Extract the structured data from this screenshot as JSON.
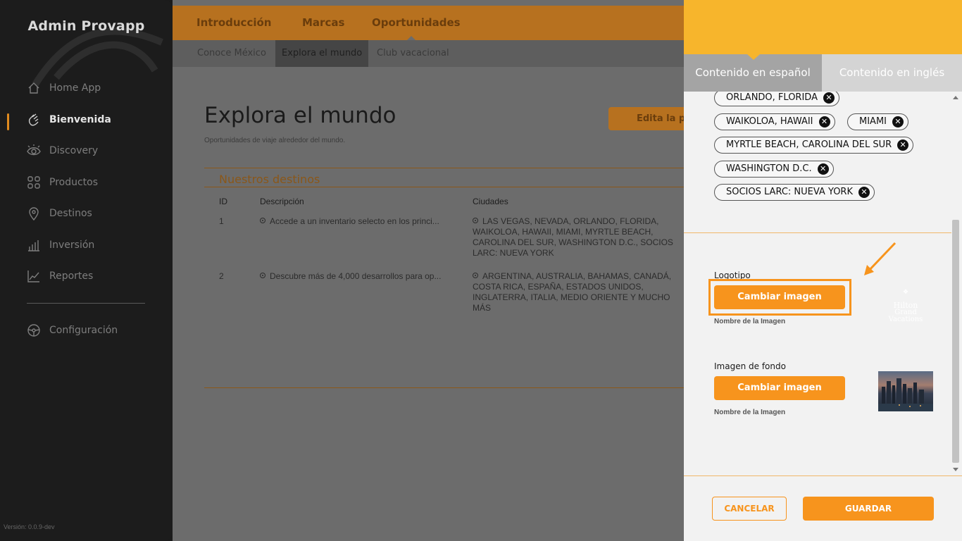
{
  "sidebar": {
    "brand": "Admin Provapp",
    "items": [
      {
        "label": "Home App",
        "icon": "home-icon"
      },
      {
        "label": "Bienvenida",
        "icon": "wave-hand-icon",
        "active": true
      },
      {
        "label": "Discovery",
        "icon": "eye-icon"
      },
      {
        "label": "Productos",
        "icon": "grid-icon"
      },
      {
        "label": "Destinos",
        "icon": "location-pin-icon"
      },
      {
        "label": "Inversión",
        "icon": "bar-chart-icon"
      },
      {
        "label": "Reportes",
        "icon": "line-chart-icon"
      }
    ],
    "settings": {
      "label": "Configuración",
      "icon": "steering-wheel-icon"
    },
    "version": "Versión: 0.0.9-dev"
  },
  "topnav": {
    "tabs": [
      "Introducción",
      "Marcas",
      "Oportunidades"
    ],
    "subtabs": [
      "Conoce México",
      "Explora el mundo",
      "Club vacacional"
    ]
  },
  "main": {
    "title": "Explora el mundo",
    "subtitle": "Oportunidades de viaje alrededor del mundo.",
    "edit_button": "Edita la po",
    "section_title": "Nuestros destinos",
    "table": {
      "headers": [
        "ID",
        "Descripción",
        "Ciudades"
      ],
      "rows": [
        {
          "id": "1",
          "description": "Accede a un inventario selecto en los princi...",
          "cities": "LAS VEGAS, NEVADA, ORLANDO, FLORIDA, WAIKOLOA, HAWAII, MIAMI, MYRTLE BEACH, CAROLINA DEL SUR, WASHINGTON D.C., SOCIOS LARC: NUEVA YORK"
        },
        {
          "id": "2",
          "description": "Descubre más de 4,000 desarrollos para op...",
          "cities": "ARGENTINA, AUSTRALIA, BAHAMAS, CANADÁ, COSTA RICA, ESPAÑA, ESTADOS UNIDOS, INGLATERRA, ITALIA, MEDIO ORIENTE Y MUCHO MÁS"
        }
      ]
    }
  },
  "panel": {
    "tabs": [
      "Contenido en español",
      "Contenido en inglés"
    ],
    "chips": [
      "ORLANDO, FLORIDA",
      "WAIKOLOA, HAWAII",
      "MIAMI",
      "MYRTLE BEACH, CAROLINA DEL SUR",
      "WASHINGTON D.C.",
      "SOCIOS LARC: NUEVA YORK"
    ],
    "logo": {
      "label": "Logotipo",
      "button": "Cambiar imagen",
      "note": "Nombre de la Imagen",
      "thumb_line1": "Hilton",
      "thumb_line2": "Grand Vacations"
    },
    "background": {
      "label": "Imagen de fondo",
      "button": "Cambiar imagen",
      "note": "Nombre de la Imagen"
    },
    "cancel": "CANCELAR",
    "save": "GUARDAR"
  },
  "colors": {
    "accent": "#f7941d",
    "panel_header": "#f7b52c",
    "sidebar_bg": "#1c1c1c"
  }
}
